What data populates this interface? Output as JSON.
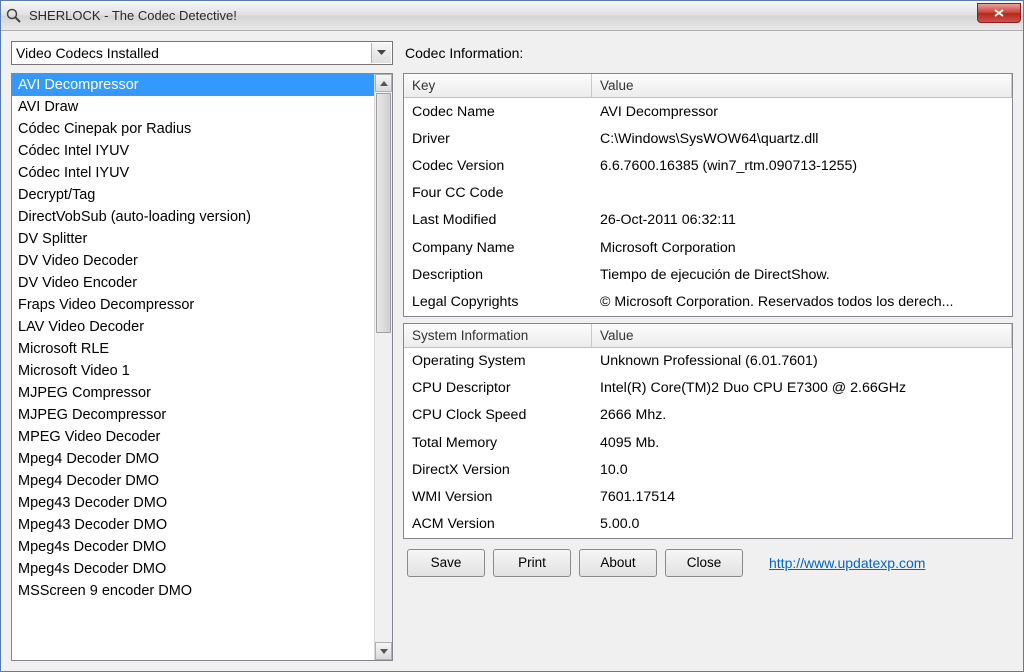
{
  "window_title": "SHERLOCK - The Codec Detective!",
  "dropdown_value": "Video Codecs Installed",
  "section_label": "Codec Information:",
  "codec_list": [
    "AVI Decompressor",
    "AVI Draw",
    "Códec Cinepak por Radius",
    "Códec Intel IYUV",
    "Códec Intel IYUV",
    "Decrypt/Tag",
    "DirectVobSub (auto-loading version)",
    "DV Splitter",
    "DV Video Decoder",
    "DV Video Encoder",
    "Fraps Video Decompressor",
    "LAV Video Decoder",
    "Microsoft RLE",
    "Microsoft Video 1",
    "MJPEG Compressor",
    "MJPEG Decompressor",
    "MPEG Video Decoder",
    "Mpeg4 Decoder DMO",
    "Mpeg4 Decoder DMO",
    "Mpeg43 Decoder DMO",
    "Mpeg43 Decoder DMO",
    "Mpeg4s Decoder DMO",
    "Mpeg4s Decoder DMO",
    "MSScreen 9 encoder DMO"
  ],
  "codec_selected_index": 0,
  "codec_header_key": "Key",
  "codec_header_val": "Value",
  "codec_info": [
    {
      "key": "Codec Name",
      "val": "AVI Decompressor"
    },
    {
      "key": "Driver",
      "val": "C:\\Windows\\SysWOW64\\quartz.dll"
    },
    {
      "key": "Codec Version",
      "val": "6.6.7600.16385 (win7_rtm.090713-1255)"
    },
    {
      "key": "Four CC Code",
      "val": ""
    },
    {
      "key": "Last Modified",
      "val": "26-Oct-2011 06:32:11"
    },
    {
      "key": "Company Name",
      "val": "Microsoft Corporation"
    },
    {
      "key": "Description",
      "val": "Tiempo de ejecución de DirectShow."
    },
    {
      "key": "Legal Copyrights",
      "val": "© Microsoft Corporation. Reservados todos los derech..."
    }
  ],
  "sys_header_key": "System Information",
  "sys_header_val": "Value",
  "sys_info": [
    {
      "key": "Operating System",
      "val": "Unknown Professional (6.01.7601)"
    },
    {
      "key": "CPU Descriptor",
      "val": "Intel(R) Core(TM)2 Duo CPU     E7300  @ 2.66GHz"
    },
    {
      "key": "CPU Clock Speed",
      "val": "2666 Mhz."
    },
    {
      "key": "Total Memory",
      "val": "4095 Mb."
    },
    {
      "key": "DirectX Version",
      "val": "10.0"
    },
    {
      "key": "WMI Version",
      "val": "7601.17514"
    },
    {
      "key": "ACM Version",
      "val": "5.00.0"
    }
  ],
  "buttons": {
    "save": "Save",
    "print": "Print",
    "about": "About",
    "close": "Close"
  },
  "link_text": "http://www.updatexp.com"
}
